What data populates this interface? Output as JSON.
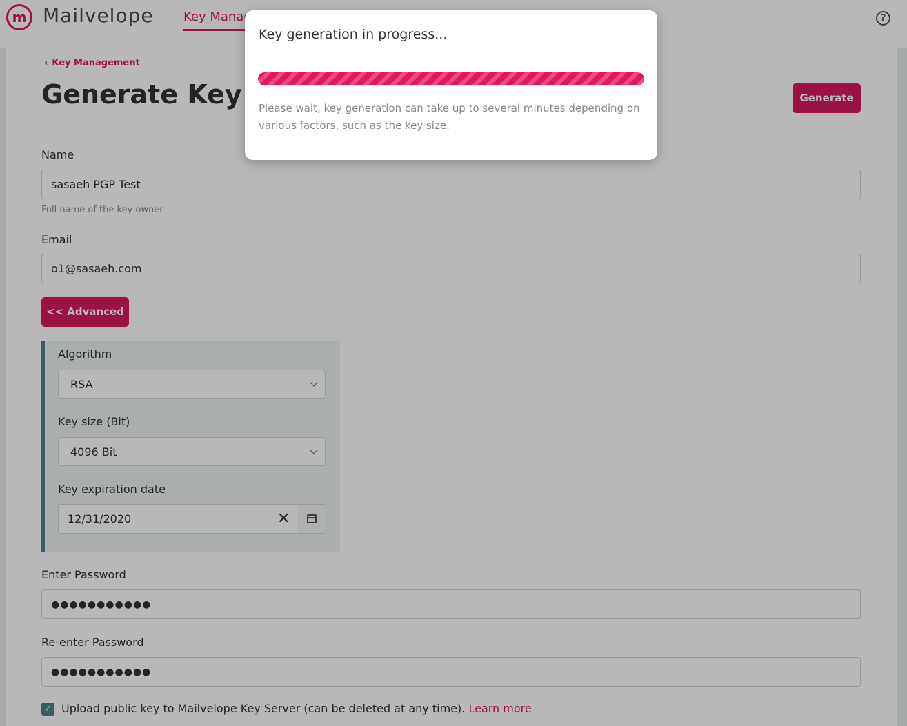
{
  "app": {
    "brand": "Mailvelope",
    "logo_letter": "m",
    "nav_tab": "Key Manag",
    "help": "?"
  },
  "page": {
    "breadcrumb": "Key Management",
    "title": "Generate Key",
    "generate_button": "Generate"
  },
  "form": {
    "name_label": "Name",
    "name_value": "sasaeh PGP Test",
    "name_hint": "Full name of the key owner",
    "email_label": "Email",
    "email_value": "o1@sasaeh.com",
    "advanced_button": "<< Advanced",
    "algorithm_label": "Algorithm",
    "algorithm_value": "RSA",
    "keysize_label": "Key size (Bit)",
    "keysize_value": "4096 Bit",
    "expiration_label": "Key expiration date",
    "expiration_value": "12/31/2020",
    "password_label": "Enter Password",
    "password_value": "●●●●●●●●●●●",
    "reenter_label": "Re-enter Password",
    "reenter_value": "●●●●●●●●●●●",
    "upload_checked": true,
    "upload_label": "Upload public key to Mailvelope Key Server (can be deleted at any time).",
    "learn_more": "Learn more"
  },
  "modal": {
    "title": "Key generation in progress...",
    "progress": 1.0,
    "message": "Please wait, key generation can take up to several minutes depending on various factors, such as the key size."
  },
  "colors": {
    "accent": "#d8195f",
    "panel_border": "#4f8288",
    "overlay": "rgba(0,0,0,0.28)"
  }
}
